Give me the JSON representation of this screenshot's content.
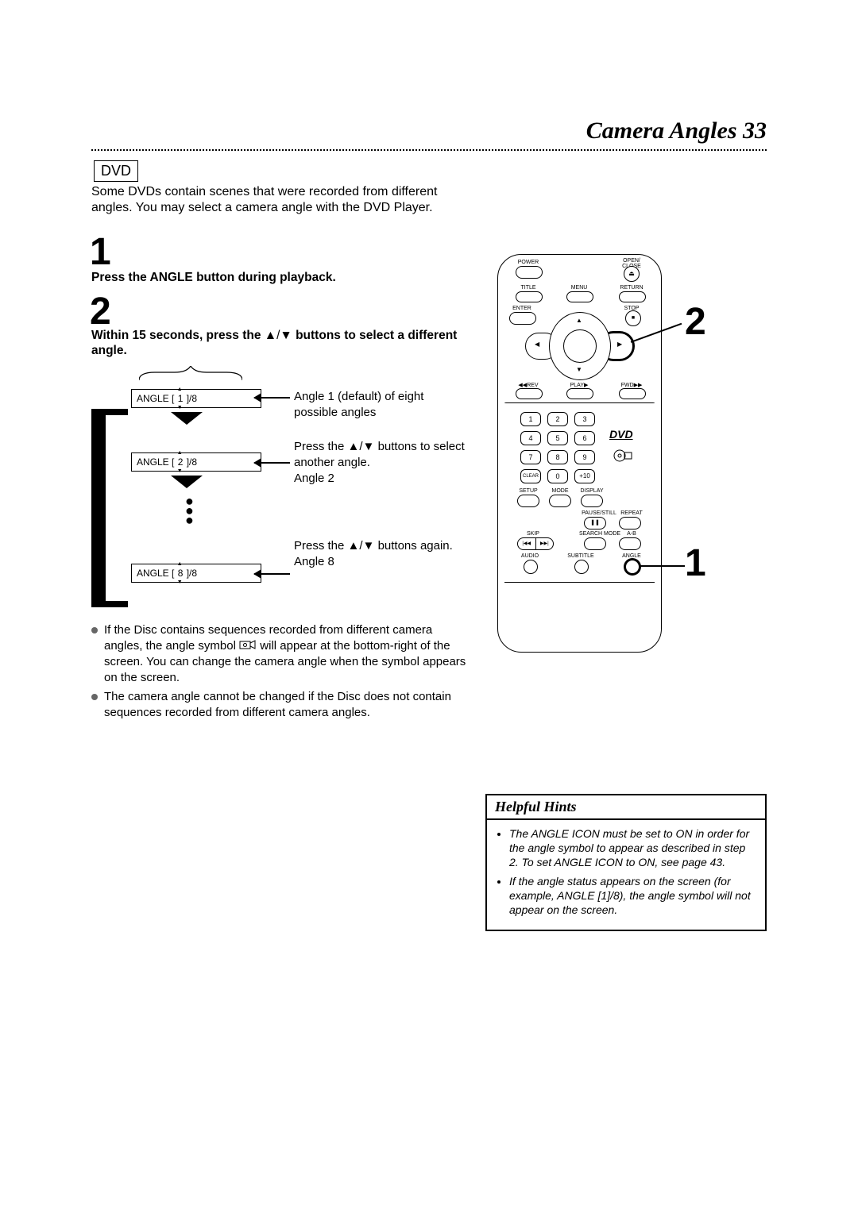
{
  "header": {
    "title": "Camera Angles",
    "page_number": "33",
    "disc_type": "DVD"
  },
  "intro": "Some DVDs contain scenes that were recorded from different angles. You may select a camera angle with the DVD Player.",
  "steps": {
    "s1_num": "1",
    "s1_text": "Press the ANGLE button during playback.",
    "s2_num": "2",
    "s2_text_a": "Within 15 seconds, press the ",
    "s2_text_b": " buttons to select a different angle."
  },
  "osd": {
    "box1": "ANGLE [ 1 ]/8",
    "box2": "ANGLE [ 2 ]/8",
    "box3": "ANGLE [ 8 ]/8",
    "desc1": "Angle 1 (default) of eight possible angles",
    "desc2a": "Press the ",
    "desc2b": " buttons to select another angle.",
    "desc2c": "Angle 2",
    "desc3a": "Press the ",
    "desc3b": " buttons again.",
    "desc3c": "Angle 8"
  },
  "bullets": {
    "b1a": "If the Disc contains sequences recorded from different camera angles, the angle symbol ",
    "b1b": " will appear at the bottom-right of the screen. You can change the camera angle when the symbol appears on the screen.",
    "b2": "The camera angle cannot be changed if the Disc does not contain sequences recorded from different camera angles."
  },
  "hints": {
    "title": "Helpful Hints",
    "h1": "The ANGLE ICON must be set to ON in order for the angle symbol to appear as described in step 2. To set ANGLE ICON to ON, see page 43.",
    "h2": "If the angle status appears on the screen (for example, ANGLE [1]/8), the angle symbol will not appear on the screen."
  },
  "remote": {
    "labels": {
      "power": "POWER",
      "open": "OPEN/\nCLOSE",
      "title_btn": "TITLE",
      "menu": "MENU",
      "return": "RETURN",
      "enter": "ENTER",
      "stop": "STOP",
      "rev": "REV",
      "play": "PLAY",
      "fwd": "FWD",
      "clear": "CLEAR",
      "plus10": "+10",
      "setup": "SETUP",
      "mode": "MODE",
      "display": "DISPLAY",
      "pause": "PAUSE/STILL",
      "repeat": "REPEAT",
      "skip": "SKIP",
      "search": "SEARCH MODE",
      "ab": "A-B",
      "audio": "AUDIO",
      "subtitle": "SUBTITLE",
      "angle": "ANGLE"
    },
    "keypad": [
      "1",
      "2",
      "3",
      "4",
      "5",
      "6",
      "7",
      "8",
      "9",
      "0"
    ],
    "logos": {
      "dvd": "DVD",
      "cd": "disc"
    },
    "callouts": {
      "c1": "1",
      "c2": "2"
    }
  }
}
